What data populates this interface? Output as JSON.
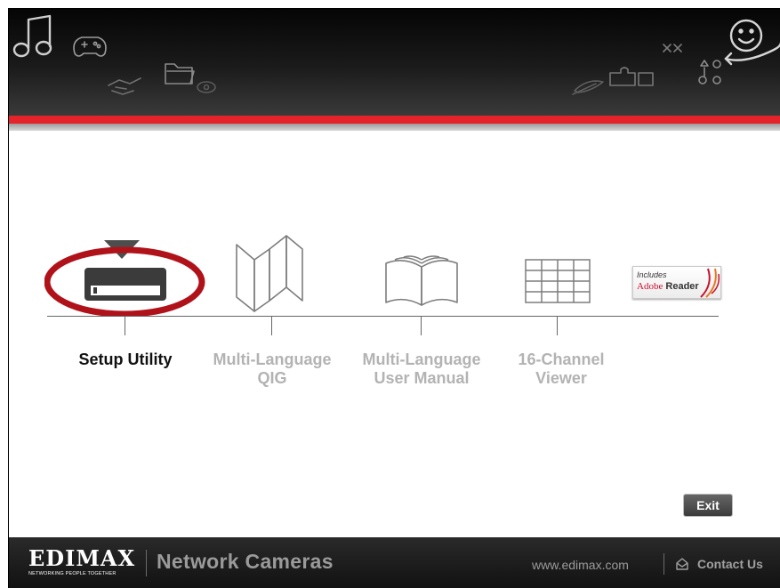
{
  "menu": {
    "items": [
      {
        "line1": "Setup Utility",
        "line2": "",
        "active": true,
        "icon": "device-icon"
      },
      {
        "line1": "Multi-Language",
        "line2": "QIG",
        "active": false,
        "icon": "folded-map-icon"
      },
      {
        "line1": "Multi-Language",
        "line2": "User Manual",
        "active": false,
        "icon": "open-book-icon"
      },
      {
        "line1": "16-Channel",
        "line2": "Viewer",
        "active": false,
        "icon": "grid-icon"
      }
    ],
    "adobe_badge": {
      "line1": "Includes",
      "brand": "Adobe",
      "product": "Reader"
    }
  },
  "exit_label": "Exit",
  "footer": {
    "logo_text": "EDIMAX",
    "tagline": "NETWORKING PEOPLE TOGETHER",
    "product": "Network Cameras",
    "website": "www.edimax.com",
    "contact": "Contact Us"
  },
  "colors": {
    "accent_red": "#e5232a",
    "highlight_ring": "#b0121a",
    "header_dark": "#111111",
    "inactive_text": "#b3b3b3"
  }
}
